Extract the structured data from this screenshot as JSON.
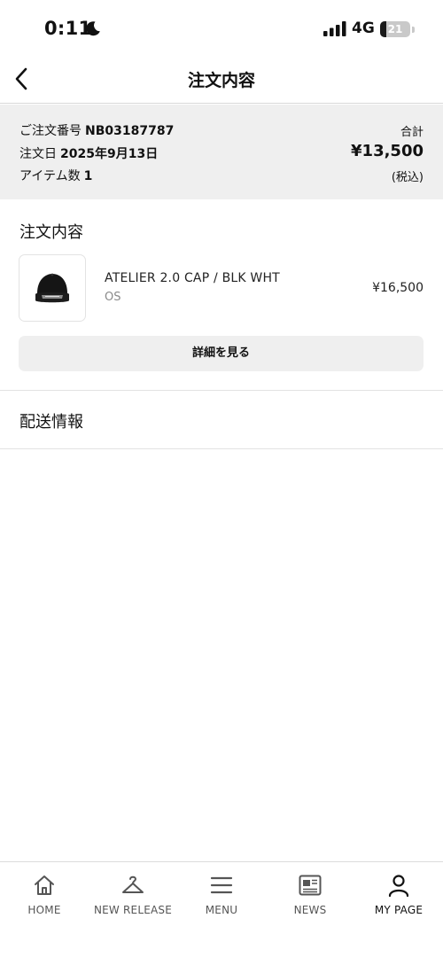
{
  "status_bar": {
    "time": "0:11",
    "network": "4G",
    "battery_level": "21",
    "battery_fraction": 0.21
  },
  "header": {
    "title": "注文内容"
  },
  "order_summary": {
    "order_number_label": "ご注文番号",
    "order_number": "NB03187787",
    "order_date_label": "注文日",
    "order_date": "2025年9月13日",
    "item_count_label": "アイテム数",
    "item_count": "1",
    "total_label": "合計",
    "total_value": "¥13,500",
    "tax_note": "(税込)"
  },
  "order_contents": {
    "heading": "注文内容",
    "items": [
      {
        "name": "ATELIER 2.0 CAP / BLK WHT",
        "size": "OS",
        "price": "¥16,500",
        "image_icon": "black-cap"
      }
    ],
    "details_button_label": "詳細を見る"
  },
  "shipping": {
    "heading": "配送情報"
  },
  "tab_bar": {
    "tabs": [
      {
        "label": "HOME",
        "icon": "home-icon",
        "active": false
      },
      {
        "label": "NEW RELEASE",
        "icon": "hanger-icon",
        "active": false
      },
      {
        "label": "MENU",
        "icon": "menu-icon",
        "active": false
      },
      {
        "label": "NEWS",
        "icon": "newspaper-icon",
        "active": false
      },
      {
        "label": "MY PAGE",
        "icon": "person-icon",
        "active": true
      }
    ]
  }
}
